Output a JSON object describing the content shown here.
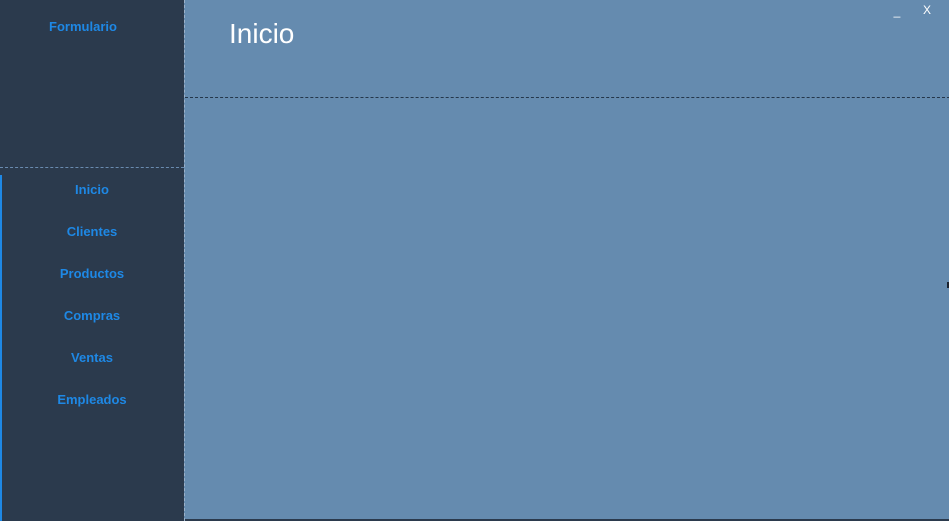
{
  "app": {
    "title": "Formulario"
  },
  "sidebar": {
    "items": [
      {
        "label": "Inicio"
      },
      {
        "label": "Clientes"
      },
      {
        "label": "Productos"
      },
      {
        "label": "Compras"
      },
      {
        "label": "Ventas"
      },
      {
        "label": "Empleados"
      }
    ]
  },
  "header": {
    "title": "Inicio",
    "minimize_label": "_",
    "close_label": "X"
  },
  "colors": {
    "sidebar_bg": "#2b3a4d",
    "main_bg": "#658baf",
    "accent": "#1e88e5",
    "title_text": "#ffffff"
  }
}
